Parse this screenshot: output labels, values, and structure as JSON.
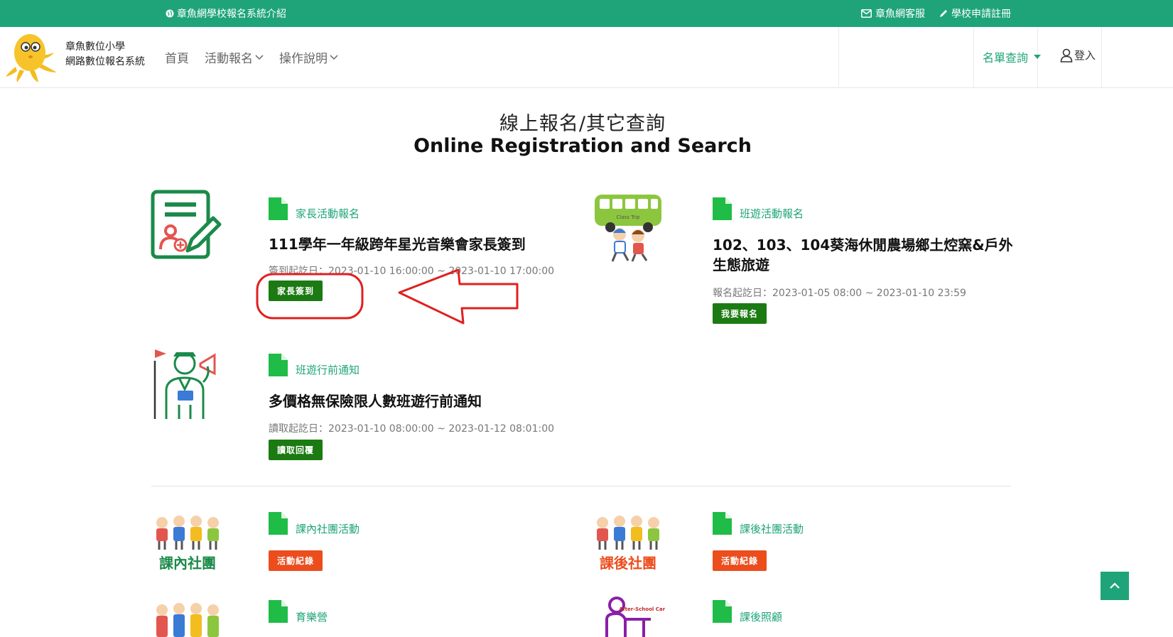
{
  "topbar": {
    "intro": "章魚網學校報名系統介紹",
    "service": "章魚網客服",
    "register": "學校申請註冊"
  },
  "header": {
    "school_name": "章魚數位小學",
    "system_name": "網路數位報名系統",
    "nav": {
      "home": "首頁",
      "activities": "活動報名",
      "guide": "操作說明"
    },
    "lookup": "名單查詢",
    "login": "登入"
  },
  "page": {
    "title_zh": "線上報名/其它查詢",
    "title_en": "Online Registration and Search"
  },
  "cards": {
    "parent": {
      "category": "家長活動報名",
      "title": "111學年一年級跨年星光音樂會家長簽到",
      "date": "簽到起訖日：2023-01-10 16:00:00 ~ 2023-01-10 17:00:00",
      "button": "家長簽到"
    },
    "trip": {
      "category": "班遊活動報名",
      "title": "102、103、104葵海休閒農場鄉土焢窯&戶外生態旅遊",
      "date": "報名起訖日：2023-01-05 08:00 ~ 2023-01-10 23:59",
      "button": "我要報名"
    },
    "notice": {
      "category": "班遊行前通知",
      "title": "多價格無保險限人數班遊行前通知",
      "date": "讀取起訖日：2023-01-10 08:00:00 ~ 2023-01-12 08:01:00",
      "button": "讀取回覆"
    },
    "club_in": {
      "icon_label": "課內社團",
      "category": "課內社團活動",
      "button": "活動紀錄"
    },
    "club_after": {
      "icon_label": "課後社團",
      "category": "課後社團活動",
      "button": "活動紀錄"
    },
    "camp": {
      "category": "育樂營"
    },
    "care": {
      "icon_label": "After-School Care",
      "category": "課後照顧"
    },
    "bus_label": "Class Trip"
  },
  "colors": {
    "brand": "#1fa47a",
    "button_green": "#1b7a12",
    "button_orange": "#ec4d1d",
    "annotation": "#e02020"
  }
}
